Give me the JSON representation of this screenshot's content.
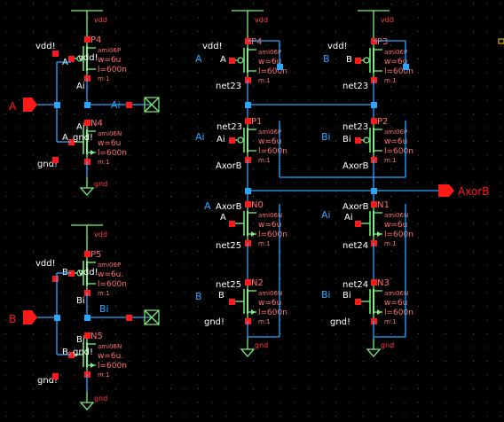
{
  "supplies": {
    "vdd": "vdd",
    "gnd": "gnd"
  },
  "pins": {
    "in_a": "A",
    "in_b": "B",
    "out": "AxorB"
  },
  "inverters": [
    {
      "pmos": {
        "name": "P4",
        "model": "ami06P",
        "w": "w=6u",
        "l": "l=600n",
        "m": "m:1",
        "d": "Ai",
        "g": "A",
        "s": "vdd!",
        "b": "vdd!"
      },
      "nmos": {
        "name": "N4",
        "model": "ami06N",
        "w": "w=6u",
        "l": "l=600n",
        "m": "m:1",
        "d": "Ai",
        "g": "A",
        "s": "gnd!",
        "b": "gnd!"
      },
      "out_label": "Ai"
    },
    {
      "pmos": {
        "name": "P5",
        "model": "ami06P",
        "w": "w=6u.",
        "l": "l=600n",
        "m": "m:1",
        "d": "Bi",
        "g": "B",
        "s": "vdd!",
        "b": "vdd!"
      },
      "nmos": {
        "name": "N5",
        "model": "ami06N",
        "w": "w=6u.",
        "l": "l=600n",
        "m": "m:1",
        "d": "Bi",
        "g": "B",
        "s": "gnd!",
        "b": "gnd!"
      },
      "out_label": "Bi"
    }
  ],
  "xor_pmos": [
    {
      "name": "P3",
      "model": "ami06P",
      "w": "w=6u",
      "l": "l=600n",
      "m": "m:1",
      "top": "vdd!",
      "bot": "net23",
      "g": "B"
    },
    {
      "name": "P4",
      "model": "ami06P",
      "w": "w=6u",
      "l": "l=600n",
      "m": "m:1",
      "top": "vdd!",
      "bot": "net23",
      "g": "A"
    },
    {
      "name": "P1",
      "model": "ami06P",
      "w": "w=6u",
      "l": "l=600n",
      "m": "m:1",
      "top": "net23",
      "bot": "AxorB",
      "g": "Ai"
    },
    {
      "name": "P2",
      "model": "ami06P",
      "w": "w=6u",
      "l": "l=600n",
      "m": "m:1",
      "top": "net23",
      "bot": "AxorB",
      "g": "Bi"
    }
  ],
  "xor_nmos": [
    {
      "name": "N0",
      "model": "ami06N",
      "w": "w=6u",
      "l": "l=600n",
      "m": "m:1",
      "top": "AxorB",
      "bot": "net25",
      "g": "A"
    },
    {
      "name": "N1",
      "model": "ami06N",
      "w": "w=6u",
      "l": "l=600n",
      "m": "m:1",
      "top": "AxorB",
      "bot": "net24",
      "g": "Ai"
    },
    {
      "name": "N2",
      "model": "ami06N",
      "w": "w=6u",
      "l": "l=600n",
      "m": "m:1",
      "top": "net25",
      "bot": "gnd!",
      "g": "B"
    },
    {
      "name": "N3",
      "model": "ami06N",
      "w": "w=6u",
      "l": "l=600n",
      "m": "m:1",
      "top": "net24",
      "bot": "gnd!",
      "g": "Bi"
    }
  ],
  "colors": {
    "background": "#000000",
    "wire": "#2aa6ff",
    "device": "#7cf07c",
    "pin": "#ff1a1a",
    "label": "#ffffff",
    "param": "#ff7070",
    "supply": "#ff4040",
    "grid": "#5a5a5a"
  }
}
